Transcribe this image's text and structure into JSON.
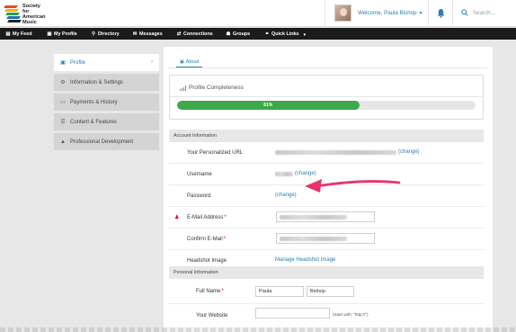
{
  "header": {
    "logo_text": "Society\nfor American\nMusic",
    "welcome": "Welcome, Paula Bishop",
    "search_placeholder": "Search..."
  },
  "nav": {
    "items": [
      {
        "label": "My Feed",
        "icon": "feed-icon"
      },
      {
        "label": "My Profile",
        "icon": "profile-icon"
      },
      {
        "label": "Directory",
        "icon": "search-icon"
      },
      {
        "label": "Messages",
        "icon": "envelope-icon"
      },
      {
        "label": "Connections",
        "icon": "connections-icon"
      },
      {
        "label": "Groups",
        "icon": "groups-icon"
      },
      {
        "label": "Quick Links",
        "icon": "link-icon"
      }
    ]
  },
  "sidebar": {
    "items": [
      {
        "label": "Profile",
        "icon": "profile-card-icon",
        "active": true
      },
      {
        "label": "Information & Settings",
        "icon": "gears-icon"
      },
      {
        "label": "Payments & History",
        "icon": "payment-icon"
      },
      {
        "label": "Content & Features",
        "icon": "list-icon"
      },
      {
        "label": "Professional Development",
        "icon": "graduation-cap-icon"
      }
    ]
  },
  "main": {
    "tab_about": "About",
    "completeness_title": "Profile Completeness",
    "progress_percent": 61,
    "progress_label": "61%",
    "account_section": "Account Information",
    "personal_section": "Personal Information",
    "rows": {
      "url_label": "Your Personalized URL",
      "change_link": "(change)",
      "username_label": "Username",
      "password_label": "Password",
      "email_label": "E-Mail Address",
      "confirm_email_label": "Confirm E-Mail",
      "headshot_label": "Headshot Image",
      "headshot_link": "Manage Headshot Image",
      "fullname_label": "Full Name",
      "first_name": "Paula",
      "last_name": "Bishop",
      "website_label": "Your Website",
      "website_hint": "(Start with: \"http://\")",
      "required_mark": "*"
    }
  },
  "colors": {
    "accent": "#2a7fb1",
    "progress": "#3ea84a",
    "annotation_arrow": "#e8346b",
    "nav_bg": "#1b1b1b"
  }
}
